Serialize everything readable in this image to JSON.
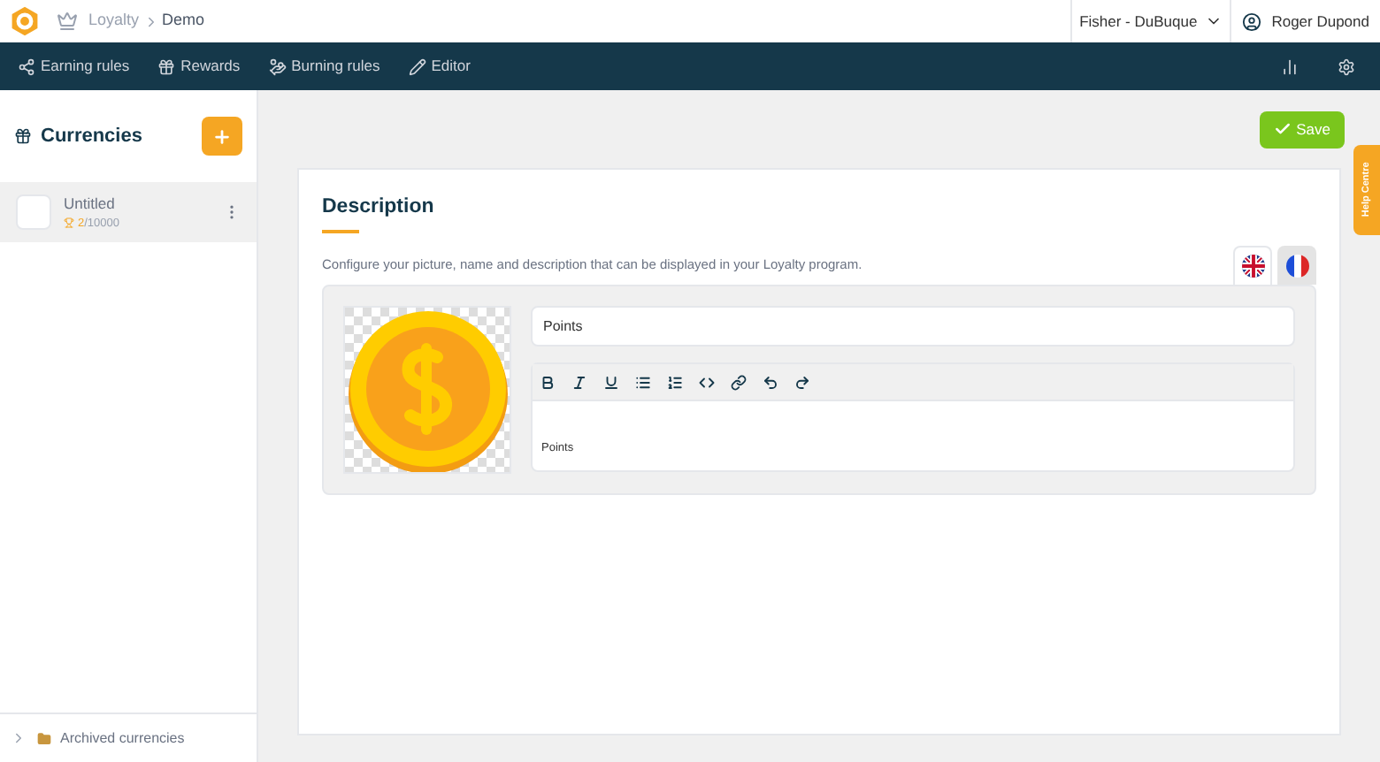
{
  "breadcrumb": {
    "items": [
      "Loyalty",
      "Demo"
    ]
  },
  "header": {
    "company": "Fisher - DuBuque",
    "user": "Roger Dupond"
  },
  "nav": {
    "items": [
      {
        "label": "Earning rules",
        "kind": "earning"
      },
      {
        "label": "Rewards",
        "kind": "rewards"
      },
      {
        "label": "Burning rules",
        "kind": "burning"
      },
      {
        "label": "Editor",
        "kind": "editor"
      }
    ]
  },
  "sidebar": {
    "title": "Currencies",
    "items": [
      {
        "name": "Untitled",
        "count": "2",
        "total": "/10000",
        "selected": true
      }
    ],
    "archived": "Archived currencies"
  },
  "save_button": "Save",
  "help_tab": "Help Centre",
  "description": {
    "title": "Description",
    "text": "Configure your picture, name and description that can be displayed in your Loyalty program.",
    "languages": [
      {
        "kind": "en",
        "selected": true
      },
      {
        "kind": "fr",
        "selected": false
      }
    ],
    "name_value": "Points",
    "editor_text": "Points"
  }
}
